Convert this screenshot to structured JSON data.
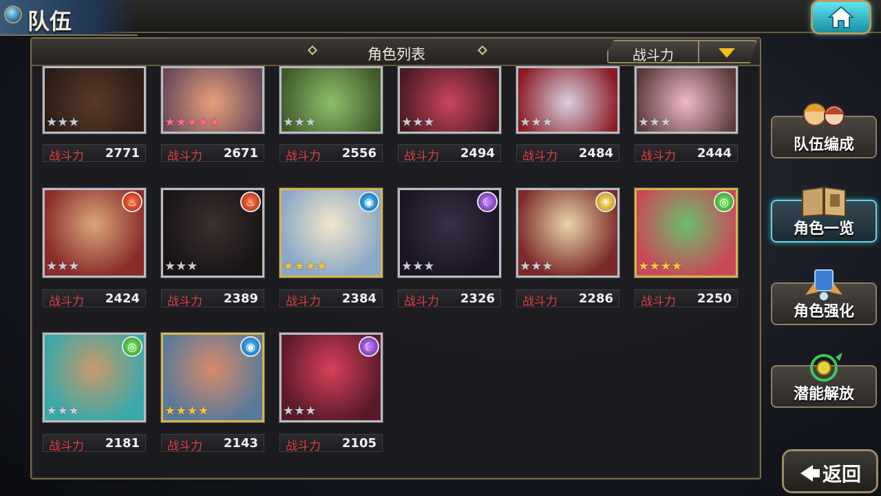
{
  "header": {
    "title": "队伍"
  },
  "panel": {
    "title": "角色列表",
    "sort_label": "战斗力"
  },
  "power_label": "战斗力",
  "characters": [
    {
      "power": "2771",
      "stars": 3,
      "star_color": "silver",
      "element": "",
      "frame": "silver"
    },
    {
      "power": "2671",
      "stars": 5,
      "star_color": "rainbow",
      "element": "",
      "frame": "silver"
    },
    {
      "power": "2556",
      "stars": 3,
      "star_color": "silver",
      "element": "",
      "frame": "silver"
    },
    {
      "power": "2494",
      "stars": 3,
      "star_color": "silver",
      "element": "",
      "frame": "silver"
    },
    {
      "power": "2484",
      "stars": 3,
      "star_color": "silver",
      "element": "",
      "frame": "silver"
    },
    {
      "power": "2444",
      "stars": 3,
      "star_color": "silver",
      "element": "",
      "frame": "silver"
    },
    {
      "power": "2424",
      "stars": 3,
      "star_color": "silver",
      "element": "fire",
      "frame": "silver"
    },
    {
      "power": "2389",
      "stars": 3,
      "star_color": "silver",
      "element": "fire",
      "frame": "silver"
    },
    {
      "power": "2384",
      "stars": 4,
      "star_color": "gold",
      "element": "water",
      "frame": "gold"
    },
    {
      "power": "2326",
      "stars": 3,
      "star_color": "silver",
      "element": "dark",
      "frame": "silver"
    },
    {
      "power": "2286",
      "stars": 3,
      "star_color": "silver",
      "element": "light",
      "frame": "silver"
    },
    {
      "power": "2250",
      "stars": 4,
      "star_color": "gold",
      "element": "wind",
      "frame": "gold"
    },
    {
      "power": "2181",
      "stars": 3,
      "star_color": "silver",
      "element": "wind",
      "frame": "silver"
    },
    {
      "power": "2143",
      "stars": 4,
      "star_color": "gold",
      "element": "water",
      "frame": "gold"
    },
    {
      "power": "2105",
      "stars": 3,
      "star_color": "silver",
      "element": "dark",
      "frame": "silver"
    }
  ],
  "side_menu": {
    "team_edit": "队伍编成",
    "char_list": "角色一览",
    "char_enhance": "角色强化",
    "potential": "潜能解放"
  },
  "back_label": "返回",
  "colors": {
    "accent": "#5fd6e6",
    "power_label": "#e04040",
    "gold_star": "#f5c542"
  }
}
